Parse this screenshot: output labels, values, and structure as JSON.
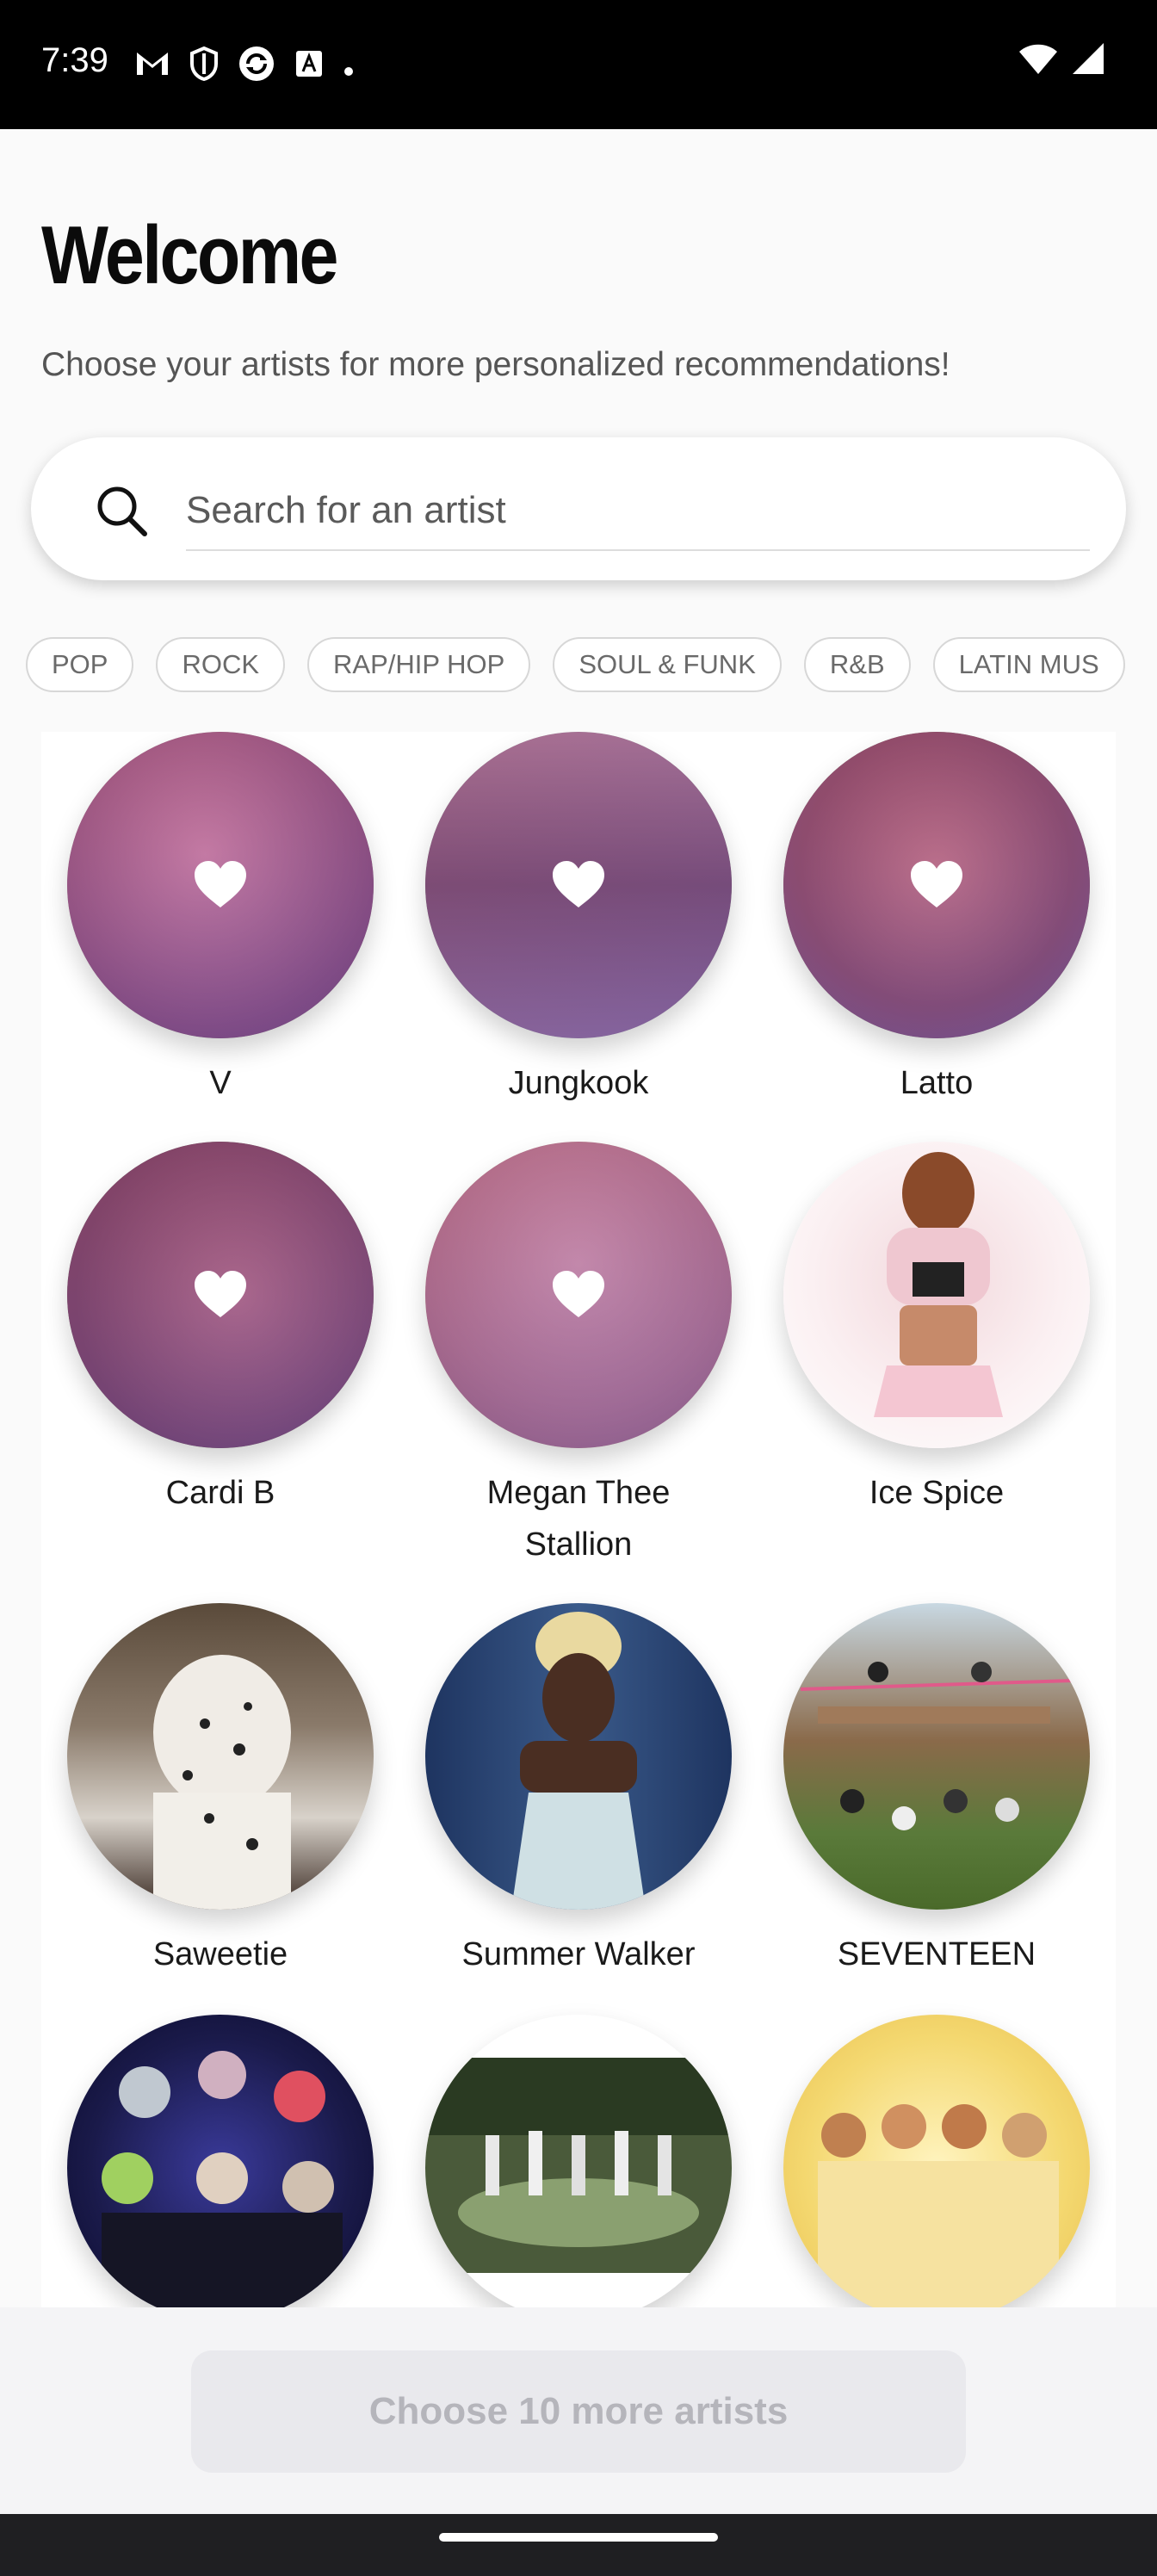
{
  "status_bar": {
    "time": "7:39",
    "left_icons": [
      "gmail-icon",
      "shield-icon",
      "sync-icon",
      "font-icon",
      "dot-icon"
    ],
    "right_icons": [
      "wifi-icon",
      "signal-icon"
    ]
  },
  "header": {
    "title": "Welcome",
    "subtitle": "Choose your artists for more personalized recommendations!"
  },
  "search": {
    "placeholder": "Search for an artist",
    "value": ""
  },
  "genres": [
    "POP",
    "ROCK",
    "RAP/HIP HOP",
    "SOUL & FUNK",
    "R&B",
    "LATIN MUS"
  ],
  "artists": [
    {
      "name": "V",
      "selected": true
    },
    {
      "name": "Jungkook",
      "selected": true
    },
    {
      "name": "Latto",
      "selected": true
    },
    {
      "name": "Cardi B",
      "selected": true
    },
    {
      "name": "Megan Thee\nStallion",
      "selected": true
    },
    {
      "name": "Ice Spice",
      "selected": false
    },
    {
      "name": "Saweetie",
      "selected": false
    },
    {
      "name": "Summer Walker",
      "selected": false
    },
    {
      "name": "SEVENTEEN",
      "selected": false
    },
    {
      "name": "",
      "selected": false
    },
    {
      "name": "",
      "selected": false
    },
    {
      "name": "",
      "selected": false
    }
  ],
  "footer": {
    "button_label": "Choose 10 more artists"
  },
  "colors": {
    "selected_overlay": "#b96aa8",
    "disabled_button_bg": "#e9e9ed",
    "disabled_button_text": "#b5b5bb"
  }
}
